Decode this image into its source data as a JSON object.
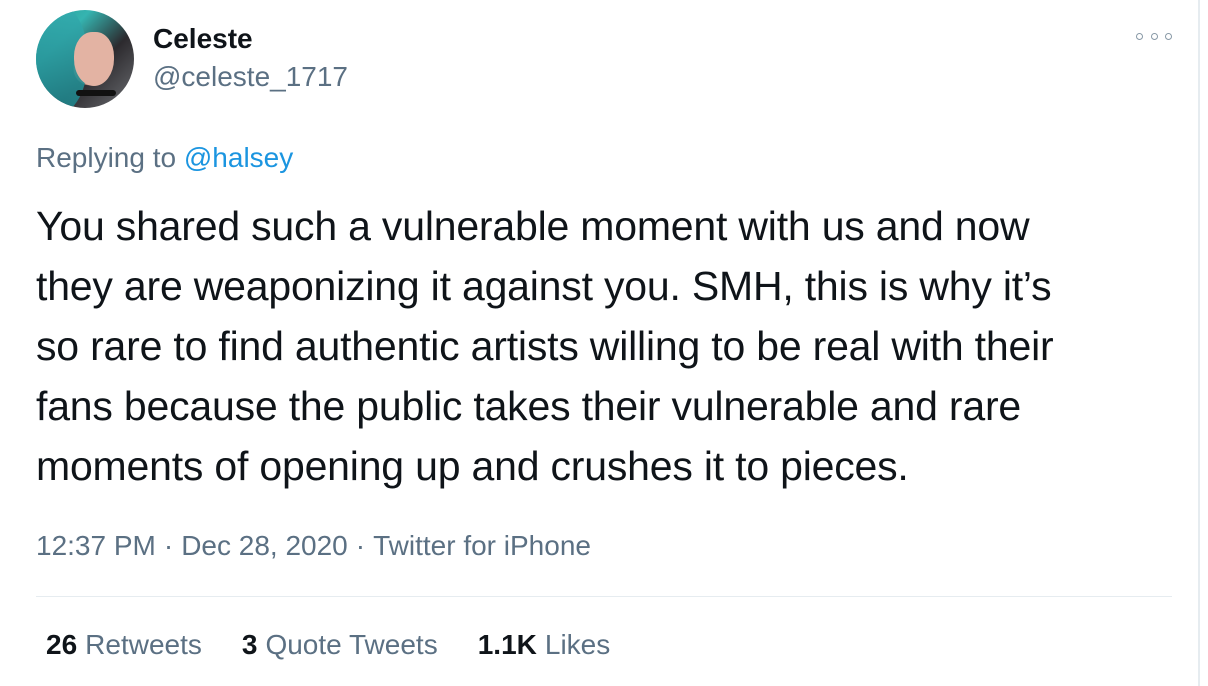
{
  "user": {
    "display_name": "Celeste",
    "handle": "@celeste_1717",
    "avatar_icon": "profile-photo"
  },
  "reply": {
    "prefix": "Replying to",
    "mention": "@halsey"
  },
  "tweet": {
    "lines": [
      "You shared such a vulnerable moment with us and now",
      "they are weaponizing it against you. SMH, this is why it’s",
      "so rare to find authentic artists willing to be real with their",
      "fans because the public takes their vulnerable and rare",
      "moments of opening up and crushes it to pieces."
    ]
  },
  "meta": {
    "time": "12:37 PM",
    "separator": "·",
    "date": "Dec 28, 2020",
    "source": "Twitter for iPhone"
  },
  "stats": {
    "retweets": {
      "count": "26",
      "label": "Retweets"
    },
    "quotes": {
      "count": "3",
      "label": "Quote Tweets"
    },
    "likes": {
      "count": "1.1K",
      "label": "Likes"
    }
  },
  "colors": {
    "text_primary": "#0f1419",
    "text_secondary": "#5b7083",
    "link": "#1b95e0",
    "divider": "#e6ecf0"
  },
  "icons": {
    "more": "more-options-icon"
  }
}
